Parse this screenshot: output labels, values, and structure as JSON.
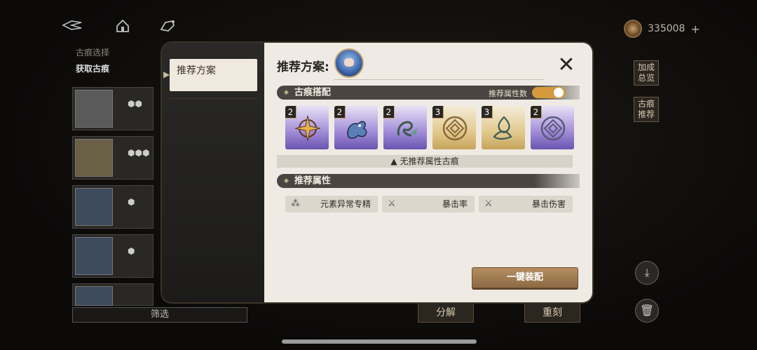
{
  "top_bar": {
    "currency_amount": "335008",
    "currency_plus": "+"
  },
  "background": {
    "breadcrumb": "古痕选择",
    "section_title": "获取古痕",
    "filter_label": "筛选",
    "side_buttons": [
      "加成\n总览",
      "古痕\n推荐"
    ],
    "bottom_buttons": [
      "分解",
      "重刻"
    ]
  },
  "modal": {
    "tab_label": "推荐方案",
    "plan_title": "推荐方案:",
    "sections": {
      "trace_match": "古痕搭配",
      "toggle_label": "推荐属性数",
      "recommended_attrs": "推荐属性"
    },
    "traces": [
      {
        "count": "2",
        "rarity": "purple",
        "icon": "compass-star-icon"
      },
      {
        "count": "2",
        "rarity": "purple",
        "icon": "dragon-icon"
      },
      {
        "count": "2",
        "rarity": "purple",
        "icon": "serpent-icon"
      },
      {
        "count": "3",
        "rarity": "gold",
        "icon": "ring-lattice-icon"
      },
      {
        "count": "3",
        "rarity": "gold",
        "icon": "trinity-knot-icon"
      },
      {
        "count": "2",
        "rarity": "purple",
        "icon": "ring-lattice-icon"
      }
    ],
    "warning_text": "无推荐属性古痕",
    "attributes": [
      {
        "label": "元素异常专精",
        "icon": "triangle-dots-icon"
      },
      {
        "label": "暴击率",
        "icon": "sword-spark-icon"
      },
      {
        "label": "暴击伤害",
        "icon": "sword-spark-icon"
      }
    ],
    "equip_button": "一键装配",
    "toggle_on": true
  },
  "colors": {
    "accent_gold": "#c7a873",
    "toggle_on": "#d49a3d",
    "purple_rarity": "#6a54b0",
    "gold_rarity": "#c7a55c",
    "section_bar": "#4a4540"
  }
}
